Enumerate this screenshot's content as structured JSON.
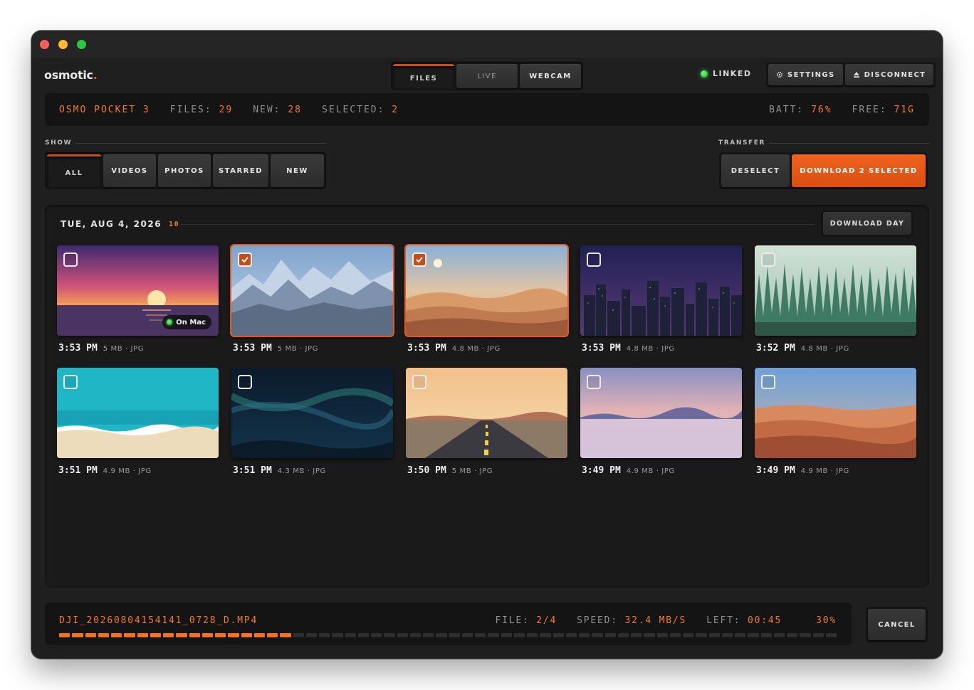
{
  "app": {
    "logo_text": "osmotic",
    "logo_dot": "."
  },
  "modes": [
    {
      "label": "FILES",
      "active": true
    },
    {
      "label": "LIVE",
      "active": false
    },
    {
      "label": "WEBCAM",
      "active": false
    }
  ],
  "connection": {
    "status": "LINKED",
    "settings_label": "SETTINGS",
    "disconnect_label": "DISCONNECT",
    "settings_icon": "gear-icon",
    "disconnect_icon": "eject-icon"
  },
  "device": {
    "name": "OSMO POCKET 3",
    "files_label": "FILES:",
    "files": "29",
    "new_label": "NEW:",
    "new": "28",
    "selected_label": "SELECTED:",
    "selected": "2",
    "batt_label": "BATT:",
    "batt": "76%",
    "free_label": "FREE:",
    "free": "71G"
  },
  "filters": {
    "label": "SHOW",
    "items": [
      {
        "label": "ALL",
        "active": true
      },
      {
        "label": "VIDEOS",
        "active": false
      },
      {
        "label": "PHOTOS",
        "active": false
      },
      {
        "label": "STARRED",
        "active": false
      },
      {
        "label": "NEW",
        "active": false
      }
    ]
  },
  "transfer": {
    "label": "TRANSFER",
    "deselect_label": "DESELECT",
    "download_label": "DOWNLOAD 2 SELECTED"
  },
  "day": {
    "title": "TUE, AUG 4, 2026",
    "count": "10",
    "download_label": "DOWNLOAD DAY"
  },
  "files": [
    {
      "time": "3:53 PM",
      "info": "5 MB · JPG",
      "selected": false,
      "on_mac": true,
      "scene": "sunset"
    },
    {
      "time": "3:53 PM",
      "info": "5 MB · JPG",
      "selected": true,
      "on_mac": false,
      "scene": "mountains"
    },
    {
      "time": "3:53 PM",
      "info": "4.8 MB · JPG",
      "selected": true,
      "on_mac": false,
      "scene": "desert-moon"
    },
    {
      "time": "3:53 PM",
      "info": "4.8 MB · JPG",
      "selected": false,
      "on_mac": false,
      "scene": "city"
    },
    {
      "time": "3:52 PM",
      "info": "4.8 MB · JPG",
      "selected": false,
      "on_mac": false,
      "scene": "forest"
    },
    {
      "time": "3:51 PM",
      "info": "4.9 MB · JPG",
      "selected": false,
      "on_mac": false,
      "scene": "beach"
    },
    {
      "time": "3:51 PM",
      "info": "4.3 MB · JPG",
      "selected": false,
      "on_mac": false,
      "scene": "aurora"
    },
    {
      "time": "3:50 PM",
      "info": "5 MB · JPG",
      "selected": false,
      "on_mac": false,
      "scene": "road"
    },
    {
      "time": "3:49 PM",
      "info": "4.9 MB · JPG",
      "selected": false,
      "on_mac": false,
      "scene": "lake"
    },
    {
      "time": "3:49 PM",
      "info": "4.9 MB · JPG",
      "selected": false,
      "on_mac": false,
      "scene": "dunes"
    }
  ],
  "on_mac_label": "On Mac",
  "progress": {
    "filename": "DJI_20260804154141_0728_D.MP4",
    "file_label": "FILE:",
    "file": "2/4",
    "speed_label": "SPEED:",
    "speed": "32.4 MB/S",
    "left_label": "LEFT:",
    "left": "00:45",
    "percent_text": "30%",
    "fraction": 0.3
  },
  "cancel_label": "CANCEL"
}
